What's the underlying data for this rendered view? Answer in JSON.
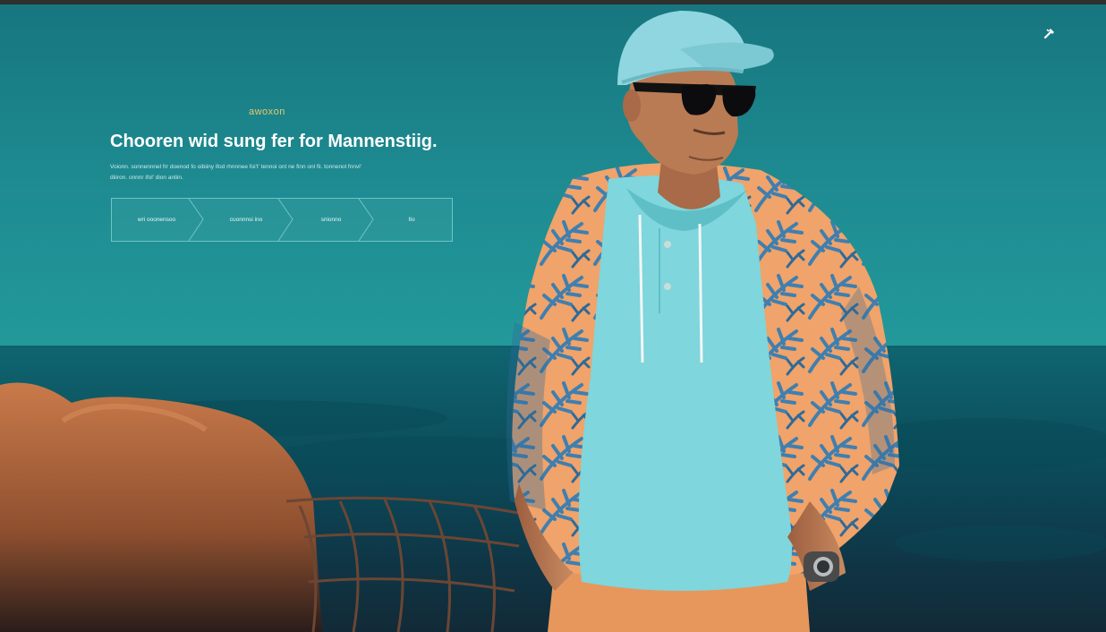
{
  "hero": {
    "eyebrow": "awoxon",
    "headline": "Chooren wid sung fer for Mannenstiig.",
    "description": "Voionn. sonnennnel frr doenod fo oibiiny ifod rhnnnee foi't' tennoi ont ne finn onl fii. tonnenol fnnvl' diiiron. onnnr ifol' dion anliin."
  },
  "steps": [
    {
      "label": "wri ooonensoo"
    },
    {
      "label": "cuonnnsi ino"
    },
    {
      "label": "snionno"
    },
    {
      "label": "IIo"
    }
  ],
  "toolbar": {
    "icon": "wrench-icon"
  },
  "colors": {
    "sky": "#1e8c92",
    "sea": "#0d5562",
    "accent": "#e8c86a",
    "jacket": "#f0a36a",
    "hoodie": "#7fd6dc"
  }
}
